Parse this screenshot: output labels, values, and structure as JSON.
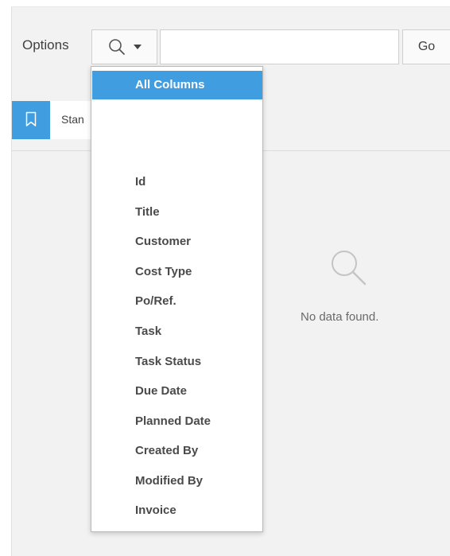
{
  "toolbar": {
    "options_label": "Options",
    "search_placeholder": "",
    "search_value": "",
    "go_label": "Go"
  },
  "report_tab": {
    "label": "Stan"
  },
  "empty_state": {
    "icon": "search-icon",
    "message": "No data found."
  },
  "column_menu": {
    "items": [
      {
        "label": "All Columns",
        "selected": true
      },
      {
        "label": "Id"
      },
      {
        "label": "Title"
      },
      {
        "label": "Customer"
      },
      {
        "label": "Cost Type"
      },
      {
        "label": "Po/Ref."
      },
      {
        "label": "Task"
      },
      {
        "label": "Task Status"
      },
      {
        "label": "Due Date"
      },
      {
        "label": "Planned Date"
      },
      {
        "label": "Created By"
      },
      {
        "label": "Modified By"
      },
      {
        "label": "Invoice"
      }
    ]
  },
  "colors": {
    "accent": "#3f9de0",
    "panel_bg": "#f2f2f2",
    "border": "#cfcfcf"
  }
}
